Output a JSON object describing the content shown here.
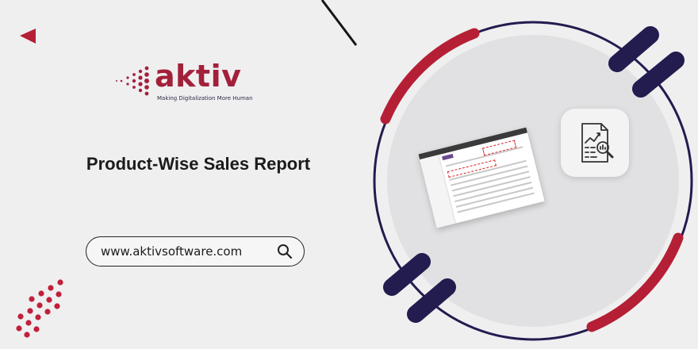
{
  "brand": {
    "name": "aktiv",
    "tagline": "Making Digitalization More Human",
    "color": "#a3203a"
  },
  "banner": {
    "title": "Product-Wise Sales Report"
  },
  "search": {
    "url": "www.aktivsoftware.com",
    "icon": "search-icon"
  },
  "colors": {
    "background": "#efeff0",
    "accent_red": "#b51f35",
    "accent_navy": "#221c4f",
    "circle_fill": "#e1e1e3"
  },
  "illustration": {
    "icon": "report-analytics-icon"
  }
}
